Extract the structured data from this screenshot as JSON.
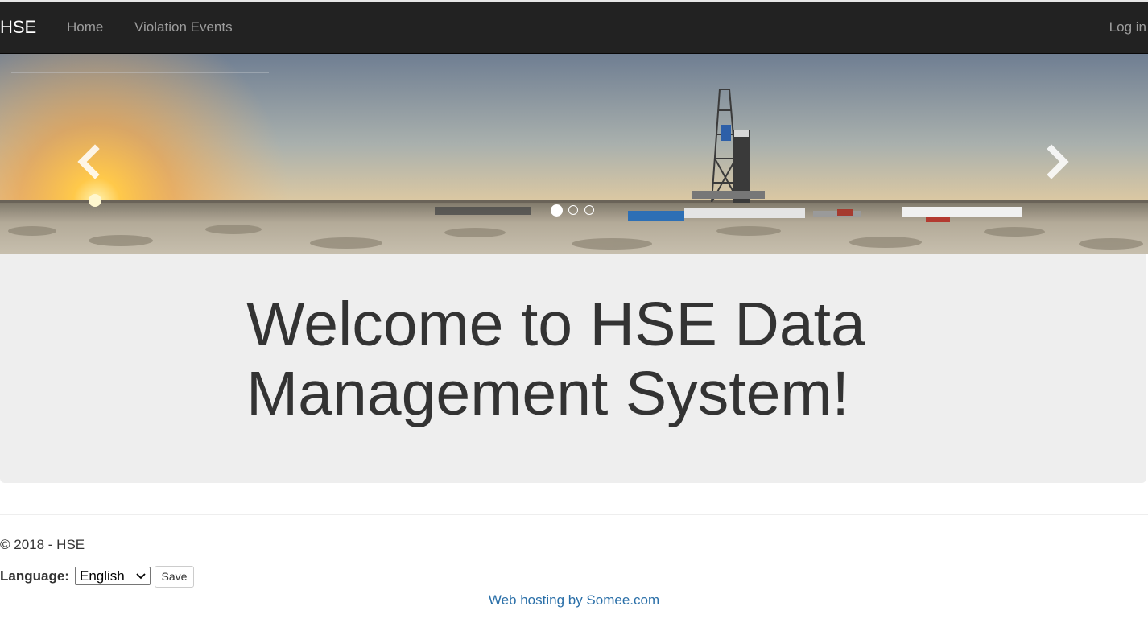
{
  "navbar": {
    "brand": "HSE",
    "links": [
      {
        "label": "Home"
      },
      {
        "label": "Violation Events"
      }
    ],
    "login_label": "Log in",
    "background": "#222222"
  },
  "carousel": {
    "slide_description_icon": "oil-rig-sunset-image",
    "prev_icon": "chevron-left-icon",
    "next_icon": "chevron-right-icon",
    "slide_count": 3,
    "active_slide": 1
  },
  "jumbotron": {
    "title": "Welcome to HSE Data Management System!",
    "background": "#eeeeee"
  },
  "footer": {
    "copyright": "© 2018 - HSE",
    "language_label": "Language:",
    "language_selected": "English",
    "save_label": "Save",
    "hosting_text": "Web hosting by Somee.com",
    "link_color": "#2a6fa8"
  }
}
